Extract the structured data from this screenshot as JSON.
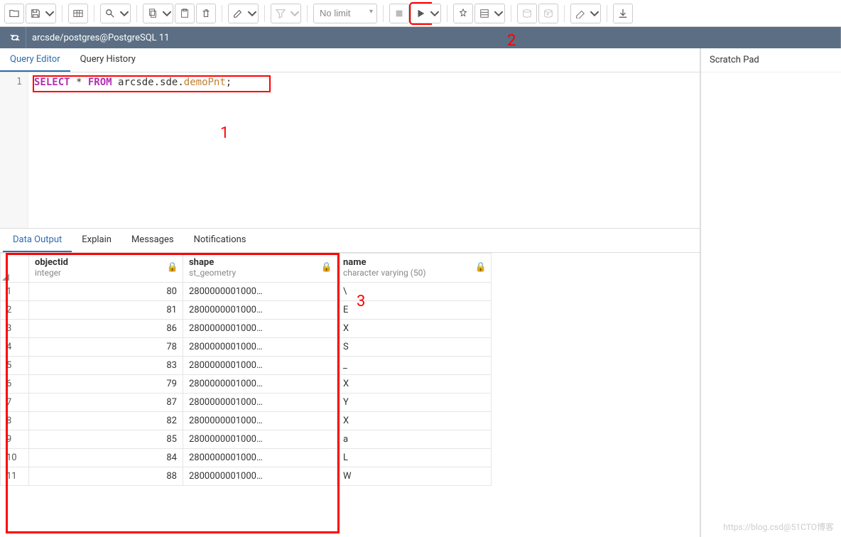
{
  "toolbar": {
    "limit_label": "No limit"
  },
  "connection": {
    "label": "arcsde/postgres@PostgreSQL 11"
  },
  "editor_tabs": {
    "query_editor": "Query Editor",
    "query_history": "Query History"
  },
  "scratch": {
    "title": "Scratch Pad"
  },
  "editor": {
    "line_number": "1",
    "sql_select": "SELECT",
    "sql_star": " * ",
    "sql_from": "FROM",
    "sql_space": " ",
    "sql_schema1": "arcsde",
    "sql_dot": ".",
    "sql_schema2": "sde",
    "sql_table": "demoPnt",
    "sql_semi": ";"
  },
  "output_tabs": {
    "data_output": "Data Output",
    "explain": "Explain",
    "messages": "Messages",
    "notifications": "Notifications"
  },
  "columns": {
    "objectid": {
      "name": "objectid",
      "type": "integer"
    },
    "shape": {
      "name": "shape",
      "type": "st_geometry"
    },
    "name": {
      "name": "name",
      "type": "character varying (50)"
    }
  },
  "rows": [
    {
      "n": "1",
      "objectid": "80",
      "shape": "2800000001000…",
      "name": "\\"
    },
    {
      "n": "2",
      "objectid": "81",
      "shape": "2800000001000…",
      "name": "E"
    },
    {
      "n": "3",
      "objectid": "86",
      "shape": "2800000001000…",
      "name": "X"
    },
    {
      "n": "4",
      "objectid": "78",
      "shape": "2800000001000…",
      "name": "S"
    },
    {
      "n": "5",
      "objectid": "83",
      "shape": "2800000001000…",
      "name": "_"
    },
    {
      "n": "6",
      "objectid": "79",
      "shape": "2800000001000…",
      "name": "X"
    },
    {
      "n": "7",
      "objectid": "87",
      "shape": "2800000001000…",
      "name": "Y"
    },
    {
      "n": "8",
      "objectid": "82",
      "shape": "2800000001000…",
      "name": "X"
    },
    {
      "n": "9",
      "objectid": "85",
      "shape": "2800000001000…",
      "name": "a"
    },
    {
      "n": "10",
      "objectid": "84",
      "shape": "2800000001000…",
      "name": "L"
    },
    {
      "n": "11",
      "objectid": "88",
      "shape": "2800000001000…",
      "name": "W"
    }
  ],
  "annotations": {
    "a1": "1",
    "a2": "2",
    "a3": "3"
  },
  "watermark": "https://blog.csd@51CTO博客"
}
